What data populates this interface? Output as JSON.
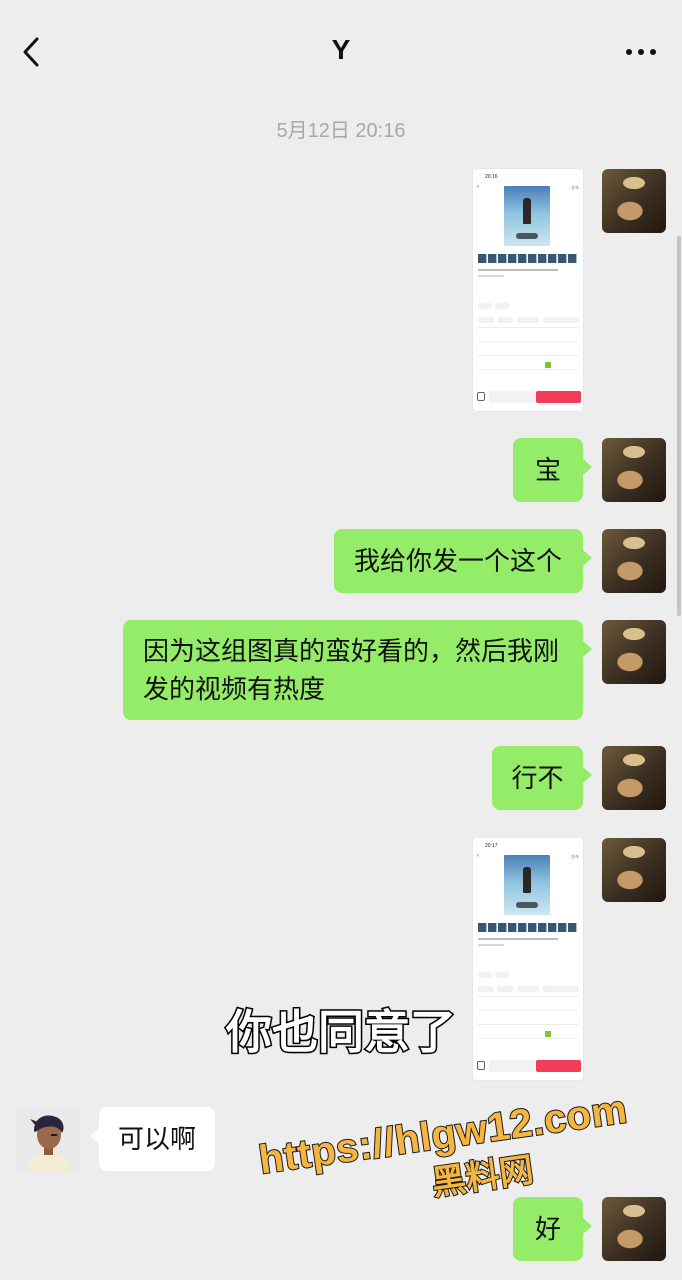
{
  "header": {
    "title": "Y",
    "back_icon": "chevron-left-icon",
    "more_icon": "more-dots-icon"
  },
  "chat": {
    "timestamp": "5月12日 20:16",
    "screenshot_1": {
      "status_time": "20:16",
      "publish_label": "发布"
    },
    "screenshot_2": {
      "status_time": "20:17",
      "publish_label": "发布"
    },
    "messages": [
      {
        "id": "m1",
        "sender": "me",
        "type": "image"
      },
      {
        "id": "m2",
        "sender": "me",
        "text": "宝"
      },
      {
        "id": "m3",
        "sender": "me",
        "text": "我给你发一个这个"
      },
      {
        "id": "m4",
        "sender": "me",
        "text": "因为这组图真的蛮好看的，然后我刚发的视频有热度"
      },
      {
        "id": "m5",
        "sender": "me",
        "text": "行不"
      },
      {
        "id": "m6",
        "sender": "me",
        "type": "image"
      },
      {
        "id": "m7",
        "sender": "other",
        "text": "可以啊"
      },
      {
        "id": "m8",
        "sender": "me",
        "text": "好"
      }
    ]
  },
  "overlay": {
    "subtitle": "你也同意了",
    "watermark_url": "https://hlgw12.com",
    "watermark_name": "黑料网"
  },
  "colors": {
    "background": "#ededed",
    "sent_bubble": "#95ec69",
    "received_bubble": "#ffffff",
    "watermark": "#f5b540"
  }
}
